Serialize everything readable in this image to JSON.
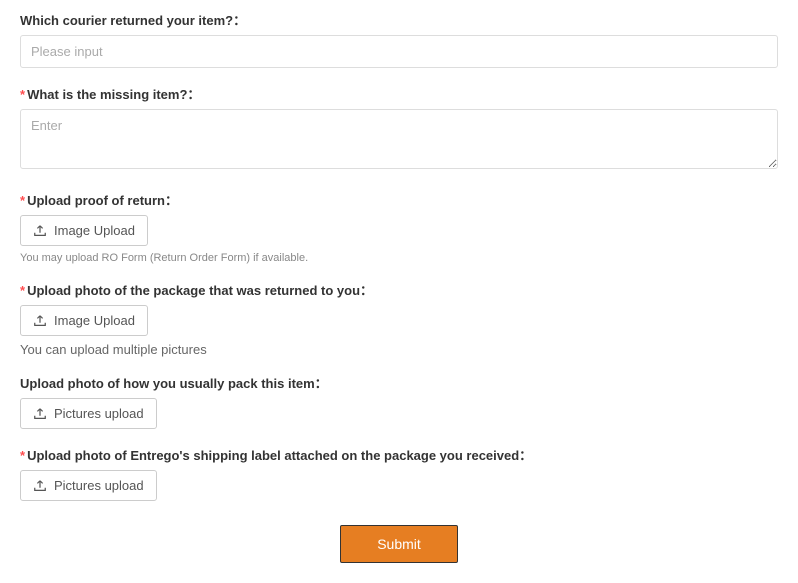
{
  "fields": {
    "courier": {
      "label": "Which courier returned your item?：",
      "placeholder": "Please input"
    },
    "missing_item": {
      "label": "What is the missing item?：",
      "placeholder": "Enter"
    },
    "proof_return": {
      "label": "Upload proof of return：",
      "button": "Image Upload",
      "help": "You may upload RO Form (Return Order Form) if available."
    },
    "package_photo": {
      "label": "Upload photo of the package that was returned to you：",
      "button": "Image Upload",
      "help": "You can upload multiple pictures"
    },
    "pack_photo": {
      "label": "Upload photo of how you usually pack this item：",
      "button": "Pictures upload"
    },
    "label_photo": {
      "label": "Upload photo of Entrego's shipping label attached on the package you received：",
      "button": "Pictures upload"
    }
  },
  "submit": "Submit"
}
